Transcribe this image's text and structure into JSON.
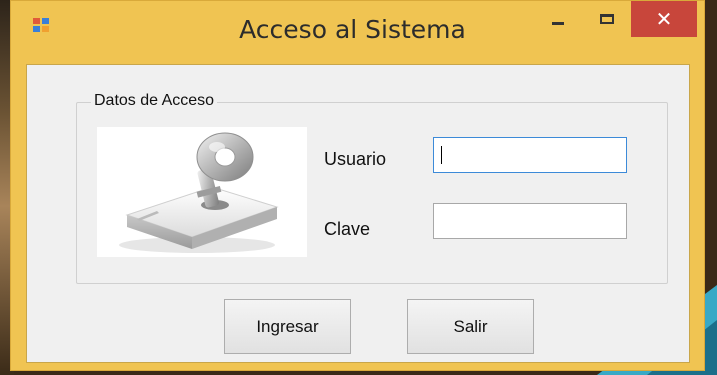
{
  "window": {
    "title": "Acceso al Sistema",
    "close_glyph": "✕",
    "frame_color": "#f0c452",
    "close_color": "#c8463b"
  },
  "icons": {
    "app": "app-icon",
    "minimize": "minimize-icon",
    "maximize": "maximize-icon",
    "close": "close-icon",
    "key_image": "key-lock-image"
  },
  "group": {
    "legend": "Datos de Acceso"
  },
  "fields": {
    "usuario": {
      "label": "Usuario",
      "value": ""
    },
    "clave": {
      "label": "Clave",
      "value": ""
    }
  },
  "buttons": {
    "ingresar": "Ingresar",
    "salir": "Salir"
  }
}
